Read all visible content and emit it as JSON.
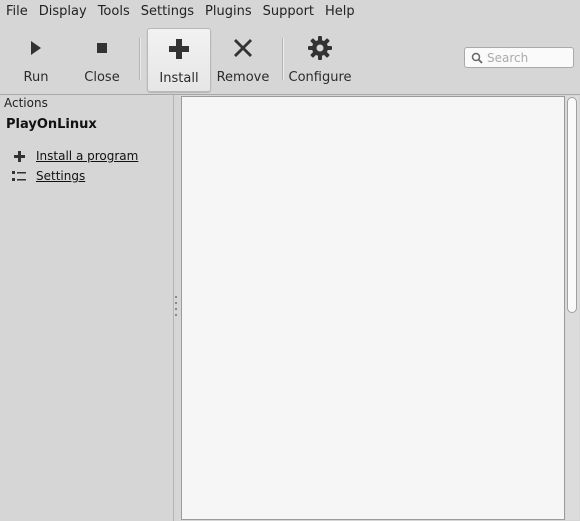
{
  "menubar": {
    "items": [
      "File",
      "Display",
      "Tools",
      "Settings",
      "Plugins",
      "Support",
      "Help"
    ]
  },
  "toolbar": {
    "run_label": "Run",
    "close_label": "Close",
    "install_label": "Install",
    "remove_label": "Remove",
    "configure_label": "Configure",
    "icons": {
      "run": "play-icon",
      "close": "stop-icon",
      "install": "plus-icon",
      "remove": "cross-icon",
      "configure": "gear-icon"
    }
  },
  "search": {
    "placeholder": "Search",
    "value": ""
  },
  "sidebar": {
    "header": "Actions",
    "title": "PlayOnLinux",
    "links": [
      {
        "label": "Install a program",
        "icon": "plus-icon"
      },
      {
        "label": "Settings",
        "icon": "settings-list-icon"
      }
    ]
  },
  "colors": {
    "window_bg": "#d6d6d6",
    "pane_bg": "#f6f6f6",
    "icon_dark": "#333333"
  }
}
